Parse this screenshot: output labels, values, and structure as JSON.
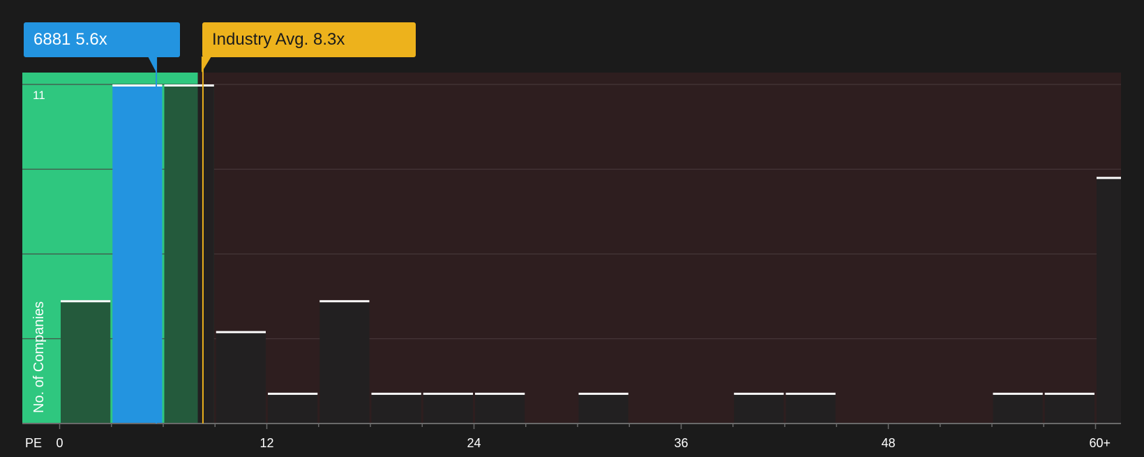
{
  "company": {
    "ticker": "6881",
    "pe_label": "5.6x",
    "color": "#2394e0"
  },
  "industry": {
    "label": "Industry Avg. 8.3x",
    "color": "#edb21c"
  },
  "colors": {
    "background": "#1b1b1b",
    "plot_background": "#2e1e1f",
    "undervalued_zone": "#2fc77f",
    "bar_dark": "#222021",
    "bar_in_zone": "#245a3c",
    "bar_top": "#ffffff",
    "grid": "#4a3c3d"
  },
  "chart_data": {
    "type": "bar",
    "title": "",
    "xlabel": "PE",
    "ylabel": "No. of Companies",
    "xlim": [
      -2,
      61.5
    ],
    "ylim": [
      0,
      11.4
    ],
    "x_ticks": [
      0,
      12,
      24,
      36,
      48,
      60
    ],
    "x_tick_labels": [
      "0",
      "12",
      "24",
      "36",
      "48",
      "60+"
    ],
    "y_ticks": [
      11
    ],
    "y_tick_labels": [
      "11"
    ],
    "gridlines_y": [
      2.75,
      5.5,
      8.25,
      11
    ],
    "bin_width": 3,
    "bins": [
      {
        "start": 0,
        "count": 4
      },
      {
        "start": 3,
        "count": 11,
        "highlighted": true
      },
      {
        "start": 6,
        "count": 11
      },
      {
        "start": 9,
        "count": 3
      },
      {
        "start": 12,
        "count": 1
      },
      {
        "start": 15,
        "count": 4
      },
      {
        "start": 18,
        "count": 1
      },
      {
        "start": 21,
        "count": 1
      },
      {
        "start": 24,
        "count": 1
      },
      {
        "start": 30,
        "count": 1
      },
      {
        "start": 39,
        "count": 1
      },
      {
        "start": 42,
        "count": 1
      },
      {
        "start": 54,
        "count": 1
      },
      {
        "start": 57,
        "count": 1
      },
      {
        "start": 60,
        "count": 8
      }
    ],
    "undervalued_zone": [
      -2,
      8
    ],
    "company_pe": 5.6,
    "industry_avg_pe": 8.3
  }
}
